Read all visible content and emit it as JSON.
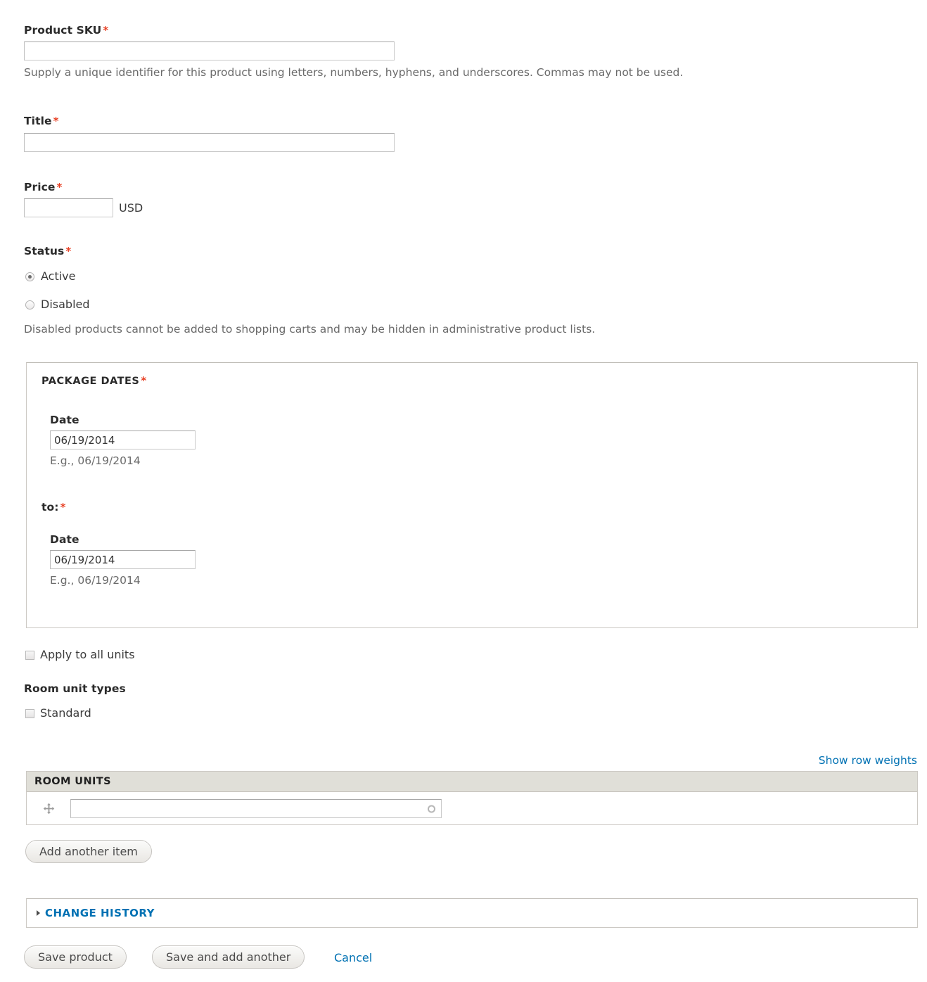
{
  "form": {
    "sku": {
      "label": "Product SKU",
      "required_marker": "*",
      "value": "",
      "placeholder": "",
      "description": "Supply a unique identifier for this product using letters, numbers, hyphens, and underscores. Commas may not be used."
    },
    "title": {
      "label": "Title",
      "required_marker": "*",
      "value": "",
      "placeholder": ""
    },
    "price": {
      "label": "Price",
      "required_marker": "*",
      "value": "",
      "placeholder": "",
      "currency": "USD"
    },
    "status": {
      "label": "Status",
      "required_marker": "*",
      "options": [
        {
          "label": "Active",
          "selected": true
        },
        {
          "label": "Disabled",
          "selected": false
        }
      ],
      "description": "Disabled products cannot be added to shopping carts and may be hidden in administrative product lists."
    },
    "package_dates": {
      "legend": "PACKAGE DATES",
      "required_marker": "*",
      "from": {
        "label": "Date",
        "value": "06/19/2014",
        "hint": "E.g., 06/19/2014"
      },
      "to_label": "to:",
      "to_required_marker": "*",
      "to": {
        "label": "Date",
        "value": "06/19/2014",
        "hint": "E.g., 06/19/2014"
      }
    },
    "apply_all": {
      "label": "Apply to all units",
      "checked": false
    },
    "room_unit_types": {
      "label": "Room unit types",
      "options": [
        {
          "label": "Standard",
          "checked": false
        }
      ]
    },
    "room_units": {
      "show_row_weights_label": "Show row weights",
      "table_header": "ROOM UNITS",
      "rows": [
        {
          "value": "",
          "placeholder": ""
        }
      ],
      "add_another_label": "Add another item"
    },
    "change_history": {
      "title": "CHANGE HISTORY",
      "expanded": false
    },
    "actions": {
      "save_label": "Save product",
      "save_add_another_label": "Save and add another",
      "cancel_label": "Cancel"
    }
  },
  "colors": {
    "required": "#e73f23",
    "link": "#0071b3",
    "table_header_bg": "#e0dfd8",
    "border": "#ccc9c4",
    "text": "#3b3b3b",
    "muted_text": "#6a6a6a"
  }
}
